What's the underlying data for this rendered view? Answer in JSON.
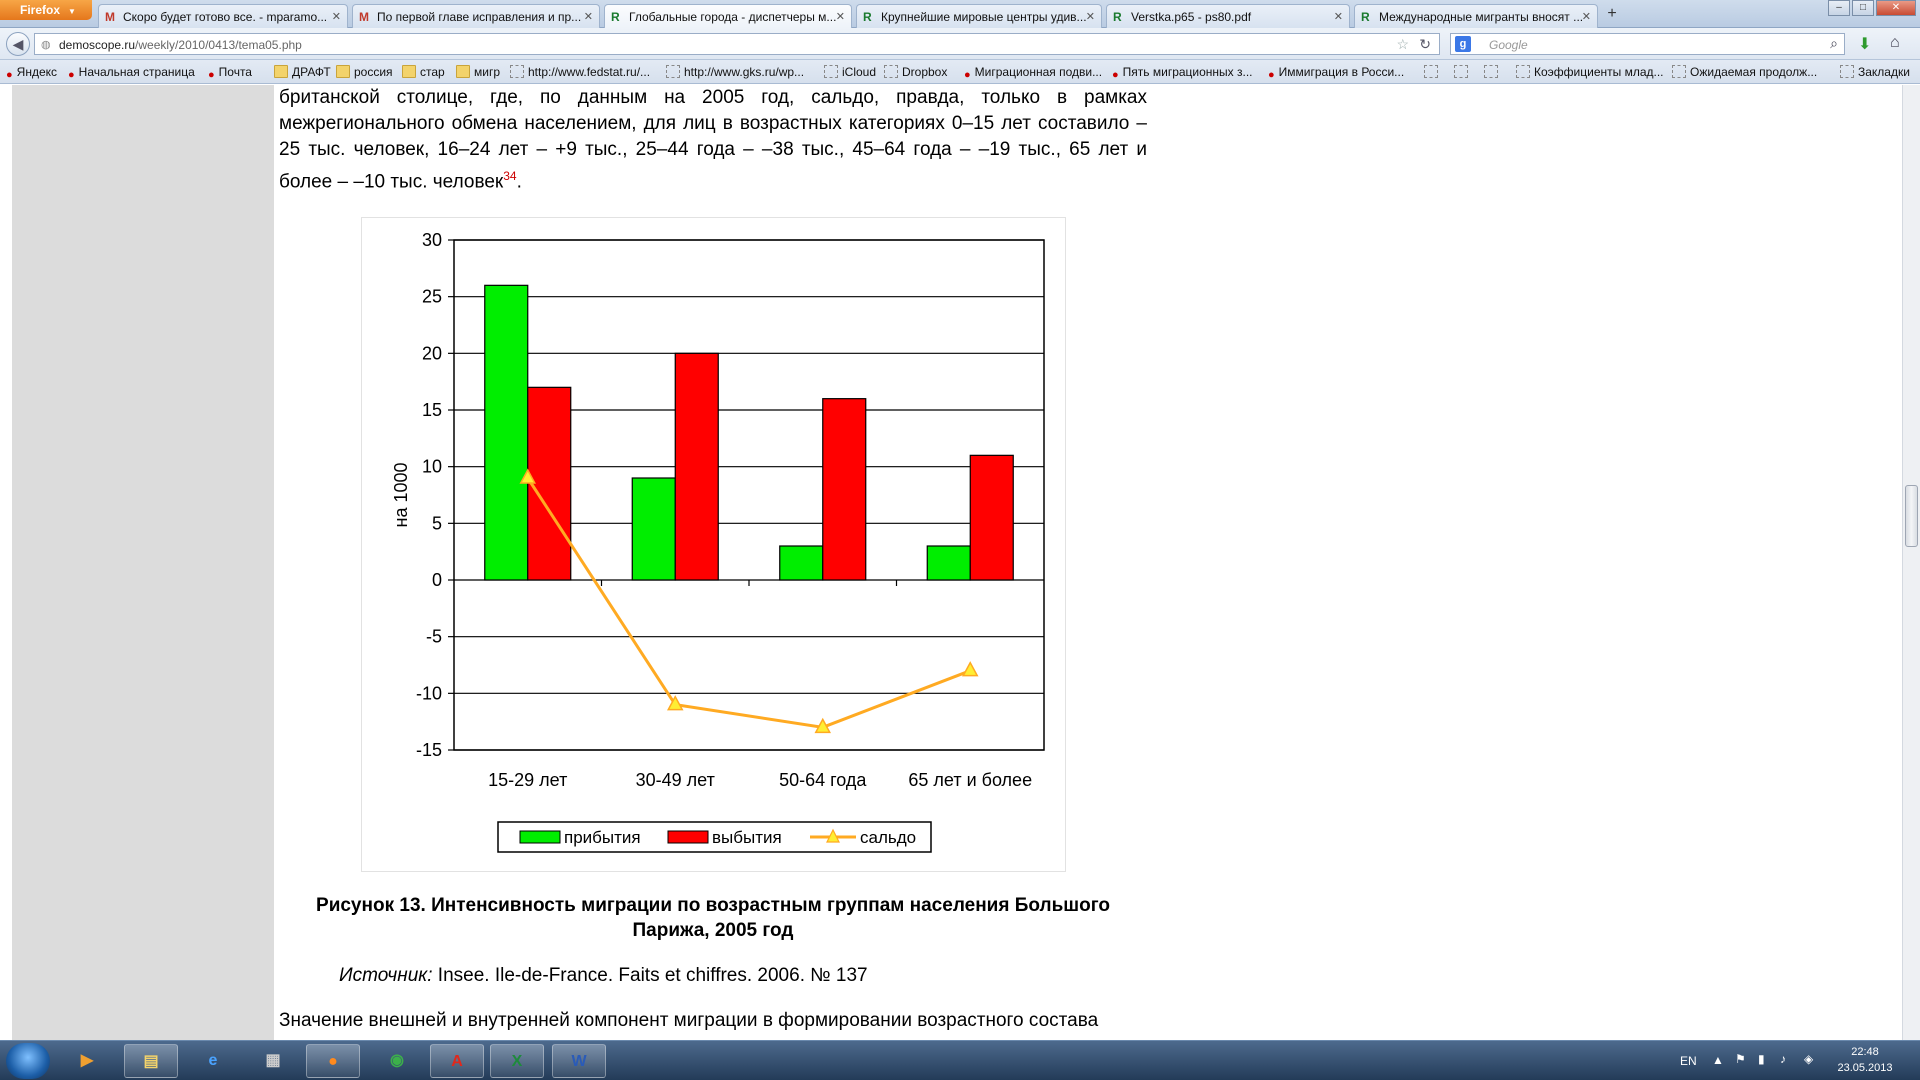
{
  "browser": {
    "menu_label": "Firefox",
    "tabs": [
      {
        "icon": "M",
        "icon_color": "#c0392b",
        "title": "Скоро будет готово все. - mparamo..."
      },
      {
        "icon": "M",
        "icon_color": "#c0392b",
        "title": "По первой главе исправления и пр..."
      },
      {
        "icon": "R",
        "icon_color": "#1a7a2e",
        "title": "Глобальные города - диспетчеры м..."
      },
      {
        "icon": "R",
        "icon_color": "#1a7a2e",
        "title": "Крупнейшие мировые центры удив..."
      },
      {
        "icon": "R",
        "icon_color": "#1a7a2e",
        "title": "Verstka.p65 - ps80.pdf"
      },
      {
        "icon": "R",
        "icon_color": "#1a7a2e",
        "title": "Международные мигранты вносят ..."
      }
    ],
    "active_tab_index": 2,
    "new_tab_label": "+",
    "url_domain": "demoscope.ru",
    "url_path": "/weekly/2010/0413/tema05.php",
    "search_placeholder": "Google",
    "bookmarks": [
      {
        "label": "Яндекс",
        "icon": "red"
      },
      {
        "label": "Начальная страница",
        "icon": "red"
      },
      {
        "label": "Почта",
        "icon": "red"
      },
      {
        "label": "ДРАФТ",
        "icon": "folder"
      },
      {
        "label": "россия",
        "icon": "folder"
      },
      {
        "label": "стар",
        "icon": "folder"
      },
      {
        "label": "мигр",
        "icon": "folder"
      },
      {
        "label": "http://www.fedstat.ru/...",
        "icon": "grey"
      },
      {
        "label": "http://www.gks.ru/wp...",
        "icon": "grey"
      },
      {
        "label": "iCloud",
        "icon": "grey"
      },
      {
        "label": "Dropbox",
        "icon": "grey"
      },
      {
        "label": "Миграционная подви...",
        "icon": "red"
      },
      {
        "label": "Пять миграционных з...",
        "icon": "red"
      },
      {
        "label": "Иммиграция в Росси...",
        "icon": "red"
      },
      {
        "label": "",
        "icon": "grey"
      },
      {
        "label": "",
        "icon": "grey"
      },
      {
        "label": "",
        "icon": "grey"
      },
      {
        "label": "Коэффициенты млад...",
        "icon": "grey"
      },
      {
        "label": "Ожидаемая продолж...",
        "icon": "grey"
      },
      {
        "label": "Закладки",
        "icon": "grey"
      }
    ]
  },
  "article": {
    "paragraph_top": "британской столице, где, по данным на 2005 год, сальдо, правда, только в рамках межрегионального обмена населением, для лиц в возрастных категориях 0–15 лет составило –25 тыс. человек, 16–24 лет – +9 тыс., 25–44 года – –38 тыс., 45–64 года – –19 тыс., 65 лет и более – –10 тыс. человек",
    "footnote": "34",
    "paragraph_top_end": ".",
    "caption": "Рисунок 13. Интенсивность миграции по возрастным группам населения Большого Парижа, 2005 год",
    "source_label": "Источник:",
    "source_text": " Insee. Ile-de-France. Faits et chiffres. 2006. № 137",
    "paragraph_bottom": "Значение внешней и внутренней компонент миграции в формировании возрастного состава"
  },
  "chart_data": {
    "type": "bar",
    "categories": [
      "15-29 лет",
      "30-49 лет",
      "50-64 года",
      "65 лет и более"
    ],
    "series": [
      {
        "name": "прибытия",
        "type": "bar",
        "color": "#00ee00",
        "values": [
          26,
          9,
          3,
          3
        ]
      },
      {
        "name": "выбытия",
        "type": "bar",
        "color": "#ff0000",
        "values": [
          17,
          20,
          16,
          11
        ]
      },
      {
        "name": "сальдо",
        "type": "line",
        "color": "#ffaa22",
        "values": [
          9,
          -11,
          -13,
          -8
        ]
      }
    ],
    "ylabel": "на 1000",
    "ylim": [
      -15,
      30
    ],
    "yticks": [
      30,
      25,
      20,
      15,
      10,
      5,
      0,
      -5,
      -10,
      -15
    ],
    "grid": true,
    "legend_position": "bottom"
  },
  "taskbar": {
    "apps": [
      {
        "name": "media-player",
        "glyph": "▶",
        "color": "#f0a030",
        "open": false
      },
      {
        "name": "explorer",
        "glyph": "▤",
        "color": "#f3d36b",
        "open": true
      },
      {
        "name": "ie",
        "glyph": "e",
        "color": "#4aa3ff",
        "open": false
      },
      {
        "name": "printer",
        "glyph": "▦",
        "color": "#cccccc",
        "open": false
      },
      {
        "name": "firefox",
        "glyph": "●",
        "color": "#ff8a1e",
        "open": true
      },
      {
        "name": "chrome",
        "glyph": "◉",
        "color": "#3cb04a",
        "open": false
      },
      {
        "name": "acrobat",
        "glyph": "A",
        "color": "#e0281c",
        "open": true
      },
      {
        "name": "excel",
        "glyph": "X",
        "color": "#1e8a3c",
        "open": true
      },
      {
        "name": "word",
        "glyph": "W",
        "color": "#2a5bb8",
        "open": true
      }
    ],
    "language": "EN",
    "time": "22:48",
    "date": "23.05.2013"
  }
}
